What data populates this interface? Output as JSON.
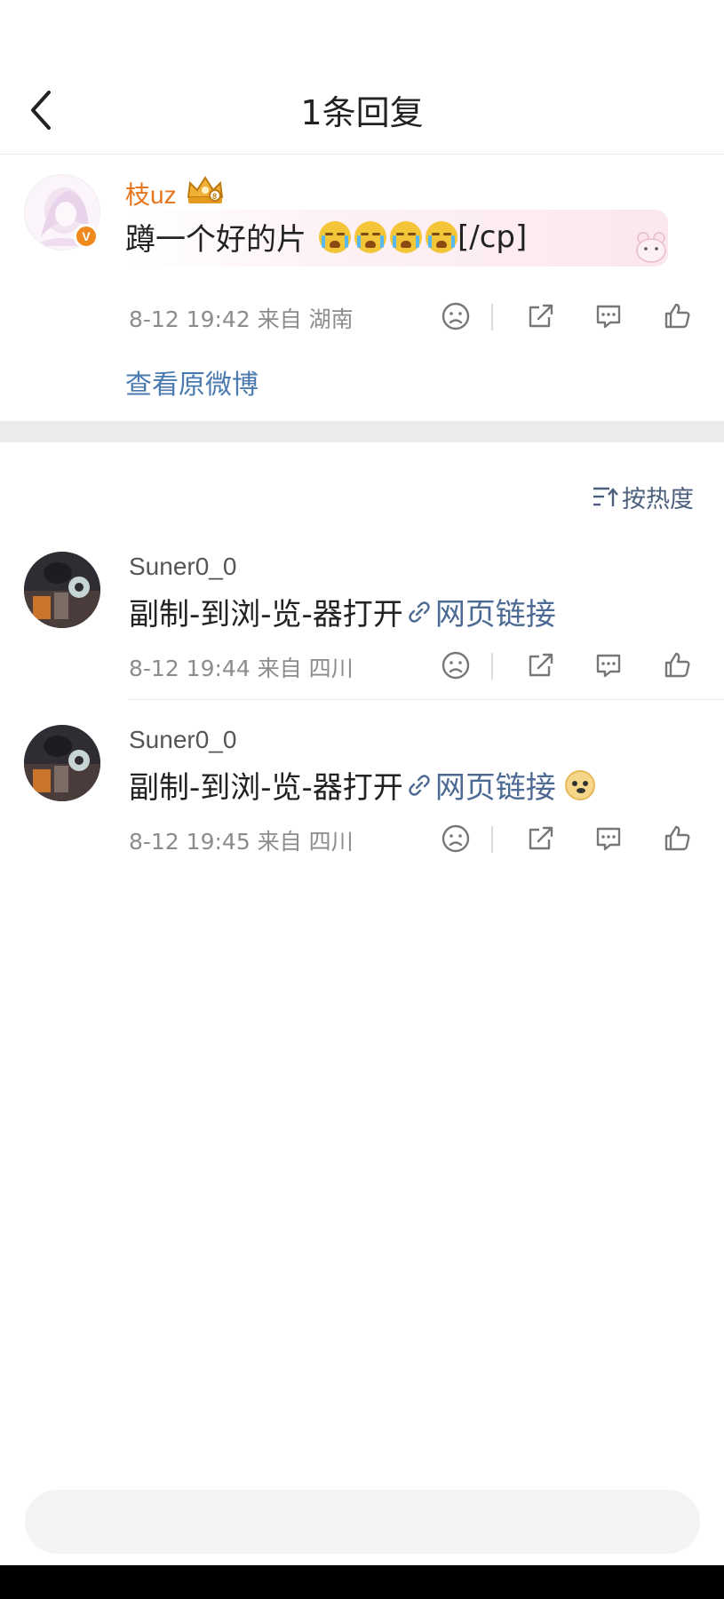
{
  "header": {
    "title": "1条回复",
    "back_icon": "chevron-left-icon"
  },
  "original_comment": {
    "username": "枝uz",
    "badge_icon": "crown-icon",
    "verified_icon": "v-badge-icon",
    "text": "蹲一个好的片",
    "emoji_icons": [
      "crying-emoji-icon",
      "crying-emoji-icon",
      "crying-emoji-icon",
      "crying-emoji-icon"
    ],
    "suffix": "[/cp]",
    "meta": "8-12 19:42  来自 湖南",
    "view_original": "查看原微博"
  },
  "sort_label": "按热度",
  "replies": [
    {
      "username": "Suner0_0",
      "text": "副制-到浏-览-器打开",
      "link_text": "网页链接",
      "meta": "8-12 19:44  来自 四川"
    },
    {
      "username": "Suner0_0",
      "text": "副制-到浏-览-器打开",
      "link_text": "网页链接",
      "emoji_icon": "doge-emoji-icon",
      "meta": "8-12 19:45  来自 四川"
    }
  ],
  "colors": {
    "accent_orange": "#e7751c",
    "link_blue": "#4c6a93"
  }
}
